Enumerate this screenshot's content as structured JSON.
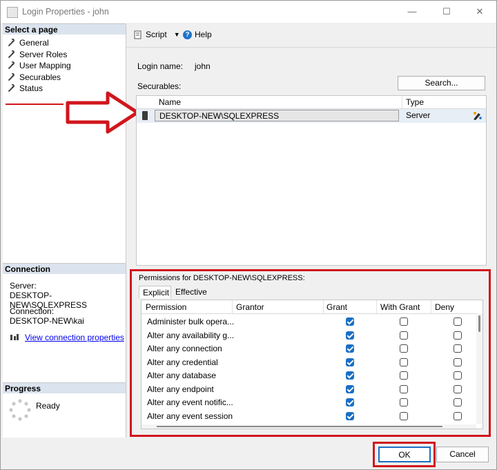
{
  "window": {
    "title": "Login Properties - john",
    "minimize": "—",
    "maximize": "☐",
    "close": "✕"
  },
  "left": {
    "select_page_header": "Select a page",
    "pages": [
      "General",
      "Server Roles",
      "User Mapping",
      "Securables",
      "Status"
    ],
    "selected_page": "Securables",
    "connection_header": "Connection",
    "server_label": "Server:",
    "server_value": "DESKTOP-NEW\\SQLEXPRESS",
    "connection_label": "Connection:",
    "connection_value": "DESKTOP-NEW\\kai",
    "view_connection_link": "View connection properties",
    "progress_header": "Progress",
    "progress_status": "Ready"
  },
  "toolbar": {
    "script_label": "Script",
    "help_label": "Help"
  },
  "main": {
    "login_name_label": "Login name:",
    "login_name_value": "john",
    "securables_label": "Securables:",
    "search_button": "Search...",
    "grid_columns": [
      "Name",
      "Type"
    ],
    "securable_row": {
      "name": "DESKTOP-NEW\\SQLEXPRESS",
      "type": "Server"
    }
  },
  "permissions": {
    "title": "Permissions for DESKTOP-NEW\\SQLEXPRESS:",
    "tabs": [
      "Explicit",
      "Effective"
    ],
    "active_tab": "Explicit",
    "columns": [
      "Permission",
      "Grantor",
      "Grant",
      "With Grant",
      "Deny"
    ],
    "rows": [
      {
        "permission": "Administer bulk opera...",
        "grant": true,
        "with_grant": false,
        "deny": false
      },
      {
        "permission": "Alter any availability g...",
        "grant": true,
        "with_grant": false,
        "deny": false
      },
      {
        "permission": "Alter any connection",
        "grant": true,
        "with_grant": false,
        "deny": false
      },
      {
        "permission": "Alter any credential",
        "grant": true,
        "with_grant": false,
        "deny": false
      },
      {
        "permission": "Alter any database",
        "grant": true,
        "with_grant": false,
        "deny": false
      },
      {
        "permission": "Alter any endpoint",
        "grant": true,
        "with_grant": false,
        "deny": false
      },
      {
        "permission": "Alter any event notific...",
        "grant": true,
        "with_grant": false,
        "deny": false
      },
      {
        "permission": "Alter any event session",
        "grant": true,
        "with_grant": false,
        "deny": false
      }
    ]
  },
  "footer": {
    "ok_label": "OK",
    "cancel_label": "Cancel"
  },
  "colors": {
    "highlight_red": "#d0161c",
    "checkbox_blue": "#1a6fc4",
    "link_blue": "#0000ee"
  }
}
